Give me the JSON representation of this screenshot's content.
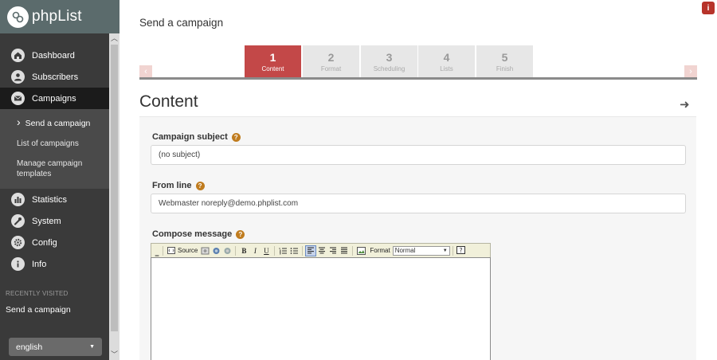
{
  "brand": {
    "name": "phpList"
  },
  "sidebar": {
    "items": [
      {
        "label": "Dashboard"
      },
      {
        "label": "Subscribers"
      },
      {
        "label": "Campaigns"
      },
      {
        "label": "Statistics"
      },
      {
        "label": "System"
      },
      {
        "label": "Config"
      },
      {
        "label": "Info"
      }
    ],
    "campaign_subitems": [
      {
        "label": "Send a campaign"
      },
      {
        "label": "List of campaigns"
      },
      {
        "label": "Manage campaign templates"
      }
    ],
    "recent_heading": "RECENTLY VISITED",
    "recent_items": [
      {
        "label": "Send a campaign"
      }
    ],
    "language": "english"
  },
  "page": {
    "title": "Send a campaign",
    "info_icon": "i",
    "section_title": "Content"
  },
  "steps": [
    {
      "number": "1",
      "label": "Content"
    },
    {
      "number": "2",
      "label": "Format"
    },
    {
      "number": "3",
      "label": "Scheduling"
    },
    {
      "number": "4",
      "label": "Lists"
    },
    {
      "number": "5",
      "label": "Finish"
    }
  ],
  "form": {
    "subject": {
      "label": "Campaign subject",
      "value": "(no subject)"
    },
    "from": {
      "label": "From line",
      "value": "Webmaster noreply@demo.phplist.com"
    },
    "compose": {
      "label": "Compose message"
    }
  },
  "editor": {
    "source_label": "Source",
    "bold": "B",
    "italic": "I",
    "underline": "U",
    "format_label": "Format",
    "format_value": "Normal"
  },
  "colors": {
    "accent": "#c34848",
    "sidebar_bg": "#3a3a3a",
    "logo_bar": "#5b6b6c",
    "help_icon": "#c07c1f"
  }
}
